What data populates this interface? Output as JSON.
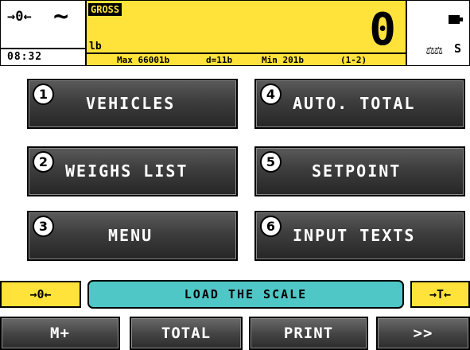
{
  "header": {
    "zero_indicator": "→0←",
    "stable_indicator": "~",
    "time": "08:32",
    "mode_badge": "GROSS",
    "unit": "lb",
    "weight": "0",
    "info": {
      "max": "Max 66001b",
      "division": "d=11b",
      "min": "Min 201b",
      "range": "(1-2)"
    },
    "battery_icon": "battery-icon",
    "scale_icon": "⚖⚖",
    "scale_number": "S"
  },
  "menu": [
    {
      "num": "1",
      "label": "VEHICLES"
    },
    {
      "num": "4",
      "label": "AUTO. TOTAL"
    },
    {
      "num": "2",
      "label": "WEIGHS LIST"
    },
    {
      "num": "5",
      "label": "SETPOINT"
    },
    {
      "num": "3",
      "label": "MENU"
    },
    {
      "num": "6",
      "label": "INPUT TEXTS"
    }
  ],
  "status": {
    "zero_button": "→0←",
    "message": "LOAD THE SCALE",
    "tare_button": "→T←"
  },
  "softkeys": [
    "M+",
    "TOTAL",
    "PRINT",
    ">>"
  ],
  "colors": {
    "display_yellow": "#ffe23a",
    "message_teal": "#4fc7c6",
    "button_dark": "#3d3d3d"
  }
}
